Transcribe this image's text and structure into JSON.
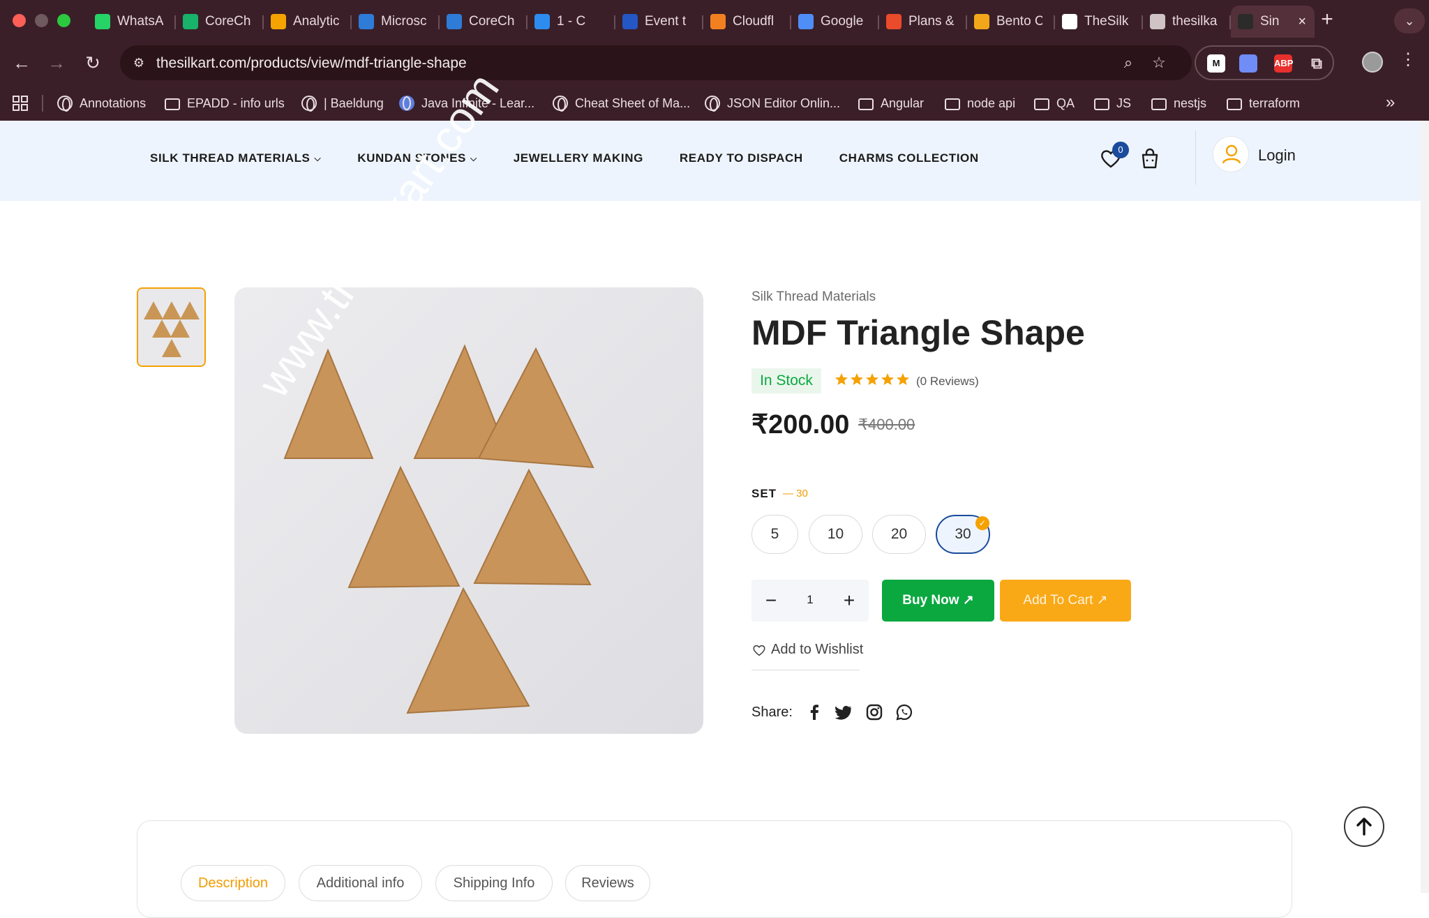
{
  "browser": {
    "tabs": [
      {
        "label": "WhatsA",
        "icon": "whatsapp-icon",
        "color": "#25d366"
      },
      {
        "label": "CoreCh",
        "icon": "bolt-icon",
        "color": "#18b26b"
      },
      {
        "label": "Analytic",
        "icon": "analytics-icon",
        "color": "#f4a300"
      },
      {
        "label": "Microsc",
        "icon": "azure-icon",
        "color": "#2f7bd8"
      },
      {
        "label": "CoreCh",
        "icon": "azure-icon",
        "color": "#2f7bd8"
      },
      {
        "label": "1 - C",
        "icon": "chat-icon",
        "color": "#2d8cf0"
      },
      {
        "label": "Event t",
        "icon": "c-icon",
        "color": "#2457c5"
      },
      {
        "label": "Cloudfl",
        "icon": "cloudflare-icon",
        "color": "#f38020"
      },
      {
        "label": "Google",
        "icon": "gemini-icon",
        "color": "#4f8ef7"
      },
      {
        "label": "Plans &",
        "icon": "red-square-icon",
        "color": "#ea4b2a"
      },
      {
        "label": "Bento C",
        "icon": "bento-icon",
        "color": "#f2a71b"
      },
      {
        "label": "TheSilk",
        "icon": "thesilk-icon",
        "color": "#ffffff"
      },
      {
        "label": "thesilka",
        "icon": "globe-icon",
        "color": "#cfc3c6"
      },
      {
        "label": "Sin",
        "icon": "hat-icon",
        "color": "#2b2b2b",
        "active": true
      }
    ],
    "new_tab_label": "+",
    "tab_menu_icon": "chevron-down-icon",
    "url": "thesilkart.com/products/view/mdf-triangle-shape",
    "bookmarks": [
      {
        "label": "Annotations",
        "icon": "globe-icon"
      },
      {
        "label": "EPADD - info urls",
        "icon": "folder-icon"
      },
      {
        "label": "| Baeldung",
        "icon": "globe-icon"
      },
      {
        "label": "Java Infinite - Lear...",
        "icon": "java-icon"
      },
      {
        "label": "Cheat Sheet of Ma...",
        "icon": "globe-icon"
      },
      {
        "label": "JSON Editor Onlin...",
        "icon": "globe-icon"
      },
      {
        "label": "Angular",
        "icon": "folder-icon"
      },
      {
        "label": "node api",
        "icon": "folder-icon"
      },
      {
        "label": "QA",
        "icon": "folder-icon"
      },
      {
        "label": "JS",
        "icon": "folder-icon"
      },
      {
        "label": "nestjs",
        "icon": "folder-icon"
      },
      {
        "label": "terraform",
        "icon": "folder-icon"
      }
    ],
    "extensions": [
      {
        "label": "M",
        "icon": "medium-icon",
        "color": "#ffffff",
        "text_color": "#111111"
      },
      {
        "label": "",
        "icon": "meet-icon",
        "color": "#6f8cf7",
        "text_color": "#ffffff"
      },
      {
        "label": "ABP",
        "icon": "adblock-icon",
        "color": "#e8302c",
        "text_color": "#ffffff"
      },
      {
        "label": "",
        "icon": "puzzle-icon",
        "color": "transparent",
        "text_color": "#e8d9dd"
      }
    ]
  },
  "site": {
    "nav": [
      {
        "label": "SILK THREAD MATERIALS",
        "dropdown": true
      },
      {
        "label": "KUNDAN STONES",
        "dropdown": true
      },
      {
        "label": "JEWELLERY MAKING",
        "dropdown": false
      },
      {
        "label": "READY TO DISPACH",
        "dropdown": false
      },
      {
        "label": "CHARMS COLLECTION",
        "dropdown": false
      }
    ],
    "wishlist_count": "0",
    "login_label": "Login"
  },
  "product": {
    "category": "Silk Thread Materials",
    "title": "MDF Triangle Shape",
    "stock": "In Stock",
    "rating": 5,
    "reviews": "(0 Reviews)",
    "price": "₹200.00",
    "old_price": "₹400.00",
    "watermark": "www.thesilkart.com",
    "set_label": "SET",
    "set_value": "— 30",
    "options": [
      "5",
      "10",
      "20",
      "30"
    ],
    "selected_option": "30",
    "quantity": "1",
    "buy_label": "Buy Now",
    "cart_label": "Add To Cart",
    "wishlist_label": "Add to Wishlist",
    "share_label": "Share:",
    "share_icons": [
      "facebook-icon",
      "twitter-icon",
      "instagram-icon",
      "whatsapp-icon"
    ],
    "tabs": [
      "Description",
      "Additional info",
      "Shipping Info",
      "Reviews"
    ],
    "active_tab": "Description"
  },
  "colors": {
    "accent_orange": "#f5a100",
    "brand_blue": "#1a4b9c",
    "buy_green": "#0aa83f",
    "header_bg": "#eef4fd"
  }
}
